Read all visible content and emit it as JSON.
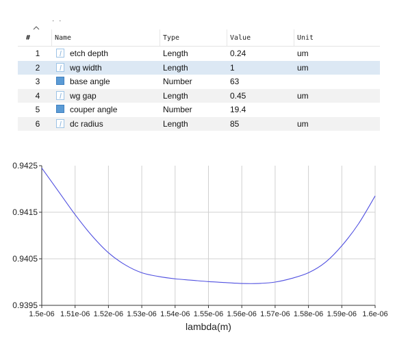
{
  "table": {
    "headers": {
      "num": "#",
      "name": "Name",
      "type": "Type",
      "value": "Value",
      "unit": "Unit"
    },
    "rows": [
      {
        "num": "1",
        "icon": "length-icon",
        "name": "etch depth",
        "type": "Length",
        "value": "0.24",
        "unit": "um"
      },
      {
        "num": "2",
        "icon": "length-icon",
        "name": "wg width",
        "type": "Length",
        "value": "1",
        "unit": "um"
      },
      {
        "num": "3",
        "icon": "number-icon",
        "name": "base angle",
        "type": "Number",
        "value": "63",
        "unit": ""
      },
      {
        "num": "4",
        "icon": "length-icon",
        "name": "wg gap",
        "type": "Length",
        "value": "0.45",
        "unit": "um"
      },
      {
        "num": "5",
        "icon": "number-icon",
        "name": "couper angle",
        "type": "Number",
        "value": "19.4",
        "unit": ""
      },
      {
        "num": "6",
        "icon": "length-icon",
        "name": "dc radius",
        "type": "Length",
        "value": "85",
        "unit": "um"
      }
    ],
    "selected_row": 1,
    "colors": {
      "selected": "#dce8f4",
      "alternate": "#f2f2f2"
    }
  },
  "chart_data": {
    "type": "line",
    "title": "",
    "xlabel": "lambda(m)",
    "ylabel": "",
    "x_tick_labels": [
      "1.5e-06",
      "1.51e-06",
      "1.52e-06",
      "1.53e-06",
      "1.54e-06",
      "1.55e-06",
      "1.56e-06",
      "1.57e-06",
      "1.58e-06",
      "1.59e-06",
      "1.6e-06"
    ],
    "y_tick_labels": [
      "0.9425",
      "0.9415",
      "0.9405",
      "0.9395"
    ],
    "xlim": [
      1.5e-06,
      1.6e-06
    ],
    "ylim": [
      0.9395,
      0.9425
    ],
    "grid": true,
    "line_color": "#4f4fe0",
    "series": [
      {
        "x": [
          1.5e-06,
          1.505e-06,
          1.51e-06,
          1.515e-06,
          1.52e-06,
          1.525e-06,
          1.53e-06,
          1.535e-06,
          1.54e-06,
          1.545e-06,
          1.55e-06,
          1.555e-06,
          1.56e-06,
          1.565e-06,
          1.57e-06,
          1.575e-06,
          1.58e-06,
          1.585e-06,
          1.59e-06,
          1.595e-06,
          1.6e-06
        ],
        "y": [
          0.94245,
          0.94195,
          0.94145,
          0.941,
          0.94063,
          0.94037,
          0.9402,
          0.94012,
          0.94007,
          0.94004,
          0.94001,
          0.93999,
          0.93997,
          0.93997,
          0.94,
          0.94008,
          0.9402,
          0.94042,
          0.94078,
          0.94125,
          0.94185
        ]
      }
    ]
  }
}
